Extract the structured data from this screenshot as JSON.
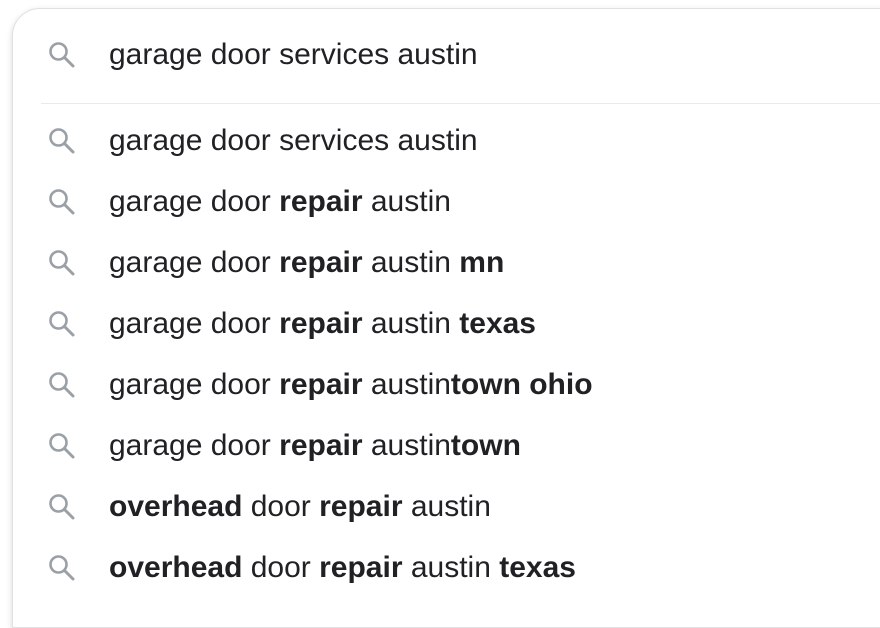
{
  "search": {
    "query": "garage door services austin",
    "icon": "search-icon"
  },
  "suggestions": [
    {
      "segments": [
        {
          "text": "garage door services austin",
          "bold": false
        }
      ]
    },
    {
      "segments": [
        {
          "text": "garage door ",
          "bold": false
        },
        {
          "text": "repair",
          "bold": true
        },
        {
          "text": " austin",
          "bold": false
        }
      ]
    },
    {
      "segments": [
        {
          "text": "garage door ",
          "bold": false
        },
        {
          "text": "repair",
          "bold": true
        },
        {
          "text": " austin ",
          "bold": false
        },
        {
          "text": "mn",
          "bold": true
        }
      ]
    },
    {
      "segments": [
        {
          "text": "garage door ",
          "bold": false
        },
        {
          "text": "repair",
          "bold": true
        },
        {
          "text": " austin ",
          "bold": false
        },
        {
          "text": "texas",
          "bold": true
        }
      ]
    },
    {
      "segments": [
        {
          "text": "garage door ",
          "bold": false
        },
        {
          "text": "repair",
          "bold": true
        },
        {
          "text": " austin",
          "bold": false
        },
        {
          "text": "town ohio",
          "bold": true
        }
      ]
    },
    {
      "segments": [
        {
          "text": "garage door ",
          "bold": false
        },
        {
          "text": "repair",
          "bold": true
        },
        {
          "text": " austin",
          "bold": false
        },
        {
          "text": "town",
          "bold": true
        }
      ]
    },
    {
      "segments": [
        {
          "text": "overhead",
          "bold": true
        },
        {
          "text": " door ",
          "bold": false
        },
        {
          "text": "repair",
          "bold": true
        },
        {
          "text": " austin",
          "bold": false
        }
      ]
    },
    {
      "segments": [
        {
          "text": "overhead",
          "bold": true
        },
        {
          "text": " door ",
          "bold": false
        },
        {
          "text": "repair",
          "bold": true
        },
        {
          "text": " austin ",
          "bold": false
        },
        {
          "text": "texas",
          "bold": true
        }
      ]
    }
  ],
  "colors": {
    "text": "#202124",
    "icon": "#9aa0a6",
    "border": "#dfe1e5"
  }
}
